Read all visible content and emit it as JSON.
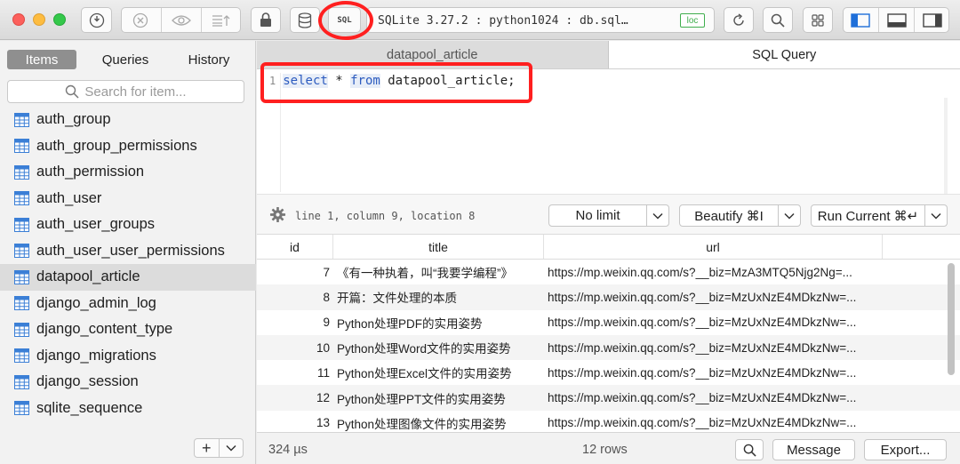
{
  "toolbar": {
    "sql_label": "SQL",
    "status": "SQLite 3.27.2 : python1024 : db.sql…",
    "loc_badge": "loc",
    "icons": [
      "power-icon",
      "stop-icon",
      "eye-icon",
      "sort-icon",
      "lock-icon",
      "database-icon",
      "sql-icon",
      "refresh-icon",
      "search-icon",
      "grid-icon",
      "left-panel-icon",
      "bottom-panel-icon",
      "right-panel-icon"
    ]
  },
  "sidebar": {
    "tabs": [
      {
        "label": "Items",
        "active": true
      },
      {
        "label": "Queries",
        "active": false
      },
      {
        "label": "History",
        "active": false
      }
    ],
    "search_placeholder": "Search for item...",
    "tables": [
      {
        "label": "auth_group"
      },
      {
        "label": "auth_group_permissions"
      },
      {
        "label": "auth_permission"
      },
      {
        "label": "auth_user"
      },
      {
        "label": "auth_user_groups"
      },
      {
        "label": "auth_user_user_permissions"
      },
      {
        "label": "datapool_article",
        "selected": true
      },
      {
        "label": "django_admin_log"
      },
      {
        "label": "django_content_type"
      },
      {
        "label": "django_migrations"
      },
      {
        "label": "django_session"
      },
      {
        "label": "sqlite_sequence"
      }
    ],
    "add_label": "+",
    "menu_label": "⌄"
  },
  "main": {
    "tabs": [
      {
        "label": "datapool_article",
        "active": false
      },
      {
        "label": "SQL Query",
        "active": true
      }
    ],
    "editor": {
      "line_number": "1",
      "kw_select": "select",
      "star": " * ",
      "kw_from": "from",
      "rest": " datapool_article;"
    },
    "cursor_info": "line 1, column 9, location 8",
    "limit": "No limit",
    "beautify": "Beautify ⌘I",
    "run": "Run Current ⌘↵",
    "columns": [
      "id",
      "title",
      "url"
    ],
    "rows": [
      {
        "id": "7",
        "title": "《有一种执着，叫“我要学编程”》",
        "url": "https://mp.weixin.qq.com/s?__biz=MzA3MTQ5Njg2Ng=..."
      },
      {
        "id": "8",
        "title": "开篇：文件处理的本质",
        "url": "https://mp.weixin.qq.com/s?__biz=MzUxNzE4MDkzNw=..."
      },
      {
        "id": "9",
        "title": "Python处理PDF的实用姿势",
        "url": "https://mp.weixin.qq.com/s?__biz=MzUxNzE4MDkzNw=..."
      },
      {
        "id": "10",
        "title": "Python处理Word文件的实用姿势",
        "url": "https://mp.weixin.qq.com/s?__biz=MzUxNzE4MDkzNw=..."
      },
      {
        "id": "11",
        "title": "Python处理Excel文件的实用姿势",
        "url": "https://mp.weixin.qq.com/s?__biz=MzUxNzE4MDkzNw=..."
      },
      {
        "id": "12",
        "title": "Python处理PPT文件的实用姿势",
        "url": "https://mp.weixin.qq.com/s?__biz=MzUxNzE4MDkzNw=..."
      },
      {
        "id": "13",
        "title": "Python处理图像文件的实用姿势",
        "url": "https://mp.weixin.qq.com/s?__biz=MzUxNzE4MDkzNw=..."
      }
    ],
    "timing": "324 µs",
    "rows_count": "12 rows",
    "message_label": "Message",
    "export_label": "Export..."
  },
  "colors": {
    "annotation": "#ff1f1f",
    "loc_badge": "#3fae4d",
    "keyword": "#2c5bbf"
  }
}
